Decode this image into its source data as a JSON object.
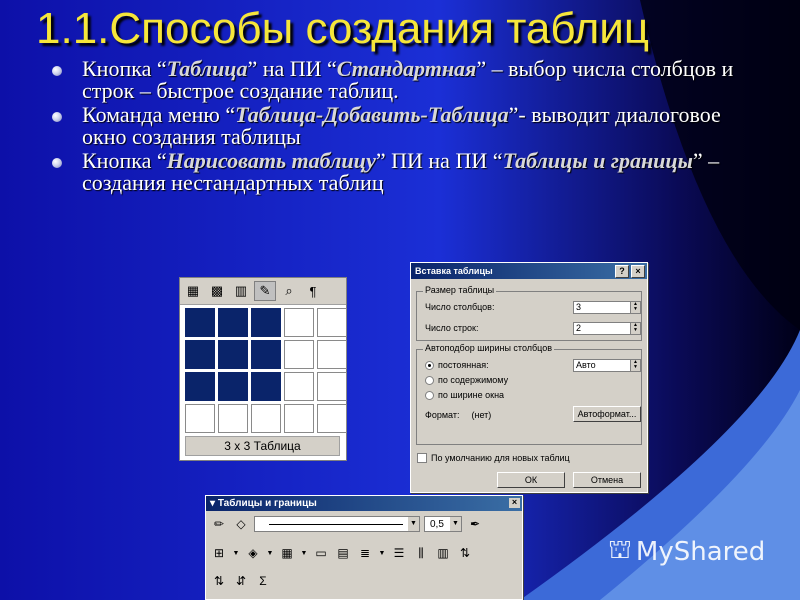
{
  "slide": {
    "title": "1.1.Способы создания таблиц",
    "bullets": [
      {
        "pre": "Кнопка “",
        "b1": "Таблица",
        "mid": "” на ПИ “",
        "b2": "Стандартная",
        "post": "” – выбор числа столбцов и строк – быстрое создание таблиц."
      },
      {
        "pre": "Команда меню “",
        "b1": "Таблица-Добавить-Таблица",
        "mid": "”- выводит диалоговое окно создания таблицы",
        "b2": "",
        "post": ""
      },
      {
        "pre": "Кнопка “",
        "b1": "Нарисовать таблицу",
        "mid": "” ПИ на ПИ “",
        "b2": "Таблицы и границы",
        "post": "” – создания нестандартных таблиц"
      }
    ]
  },
  "picker": {
    "toolbar_icons": [
      "table-icon",
      "excel-icon",
      "columns-icon",
      "draw-icon",
      "zoom-icon",
      "pilcrow-icon"
    ],
    "toolbar_glyphs": [
      "▦",
      "▩",
      "▥",
      "✎",
      "⌕",
      "¶"
    ],
    "rows": 4,
    "cols": 5,
    "selected_rows": 3,
    "selected_cols": 3,
    "label": "3 x 3 Таблица"
  },
  "dialog": {
    "title": "Вставка таблицы",
    "help": "?",
    "close": "×",
    "size_group": "Размер таблицы",
    "cols_label": "Число столбцов:",
    "cols_value": "3",
    "rows_label": "Число строк:",
    "rows_value": "2",
    "autofit_group": "Автоподбор ширины столбцов",
    "opt_fixed": "постоянная:",
    "opt_fixed_value": "Авто",
    "opt_content": "по содержимому",
    "opt_window": "по ширине окна",
    "format_label": "Формат:",
    "format_value": "(нет)",
    "autoformat_button": "Автоформат...",
    "default_checkbox": "По умолчанию для новых таблиц",
    "ok": "ОК",
    "cancel": "Отмена"
  },
  "tables_toolbar": {
    "title": "Таблицы и границы",
    "close": "×",
    "line_weight": "0,5"
  },
  "brand": {
    "name": "MyShared"
  }
}
